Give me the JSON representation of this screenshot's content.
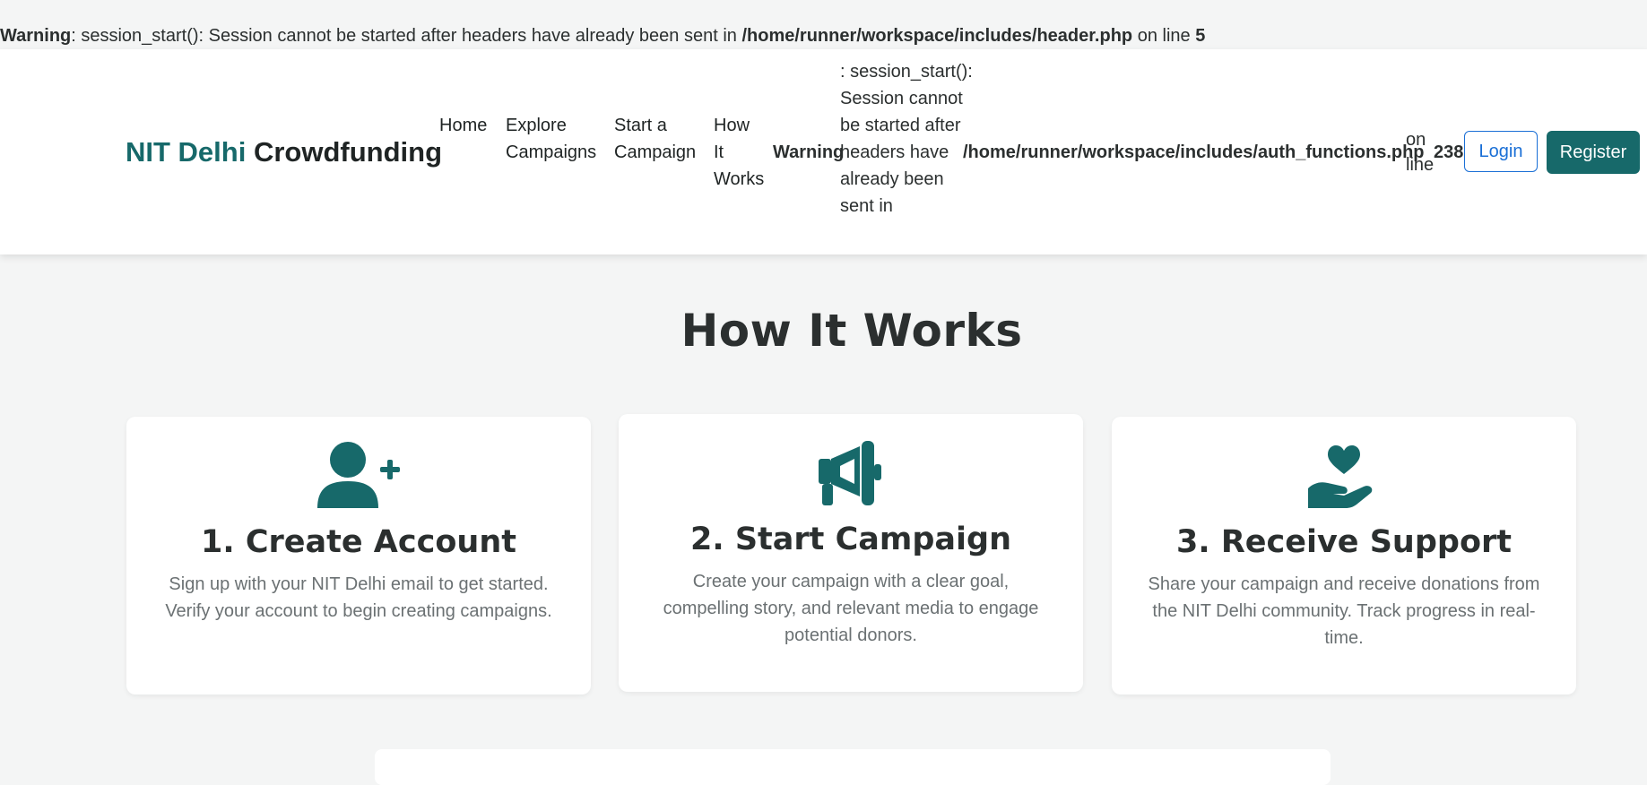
{
  "php_warning_top": {
    "label": "Warning",
    "message": ": session_start(): Session cannot be started after headers have already been sent in ",
    "path": "/home/runner/workspace/includes/header.php",
    "on_line": " on line ",
    "line": "5"
  },
  "navbar": {
    "brand_accent": "NIT Delhi",
    "brand_rest": "Crowdfunding",
    "links": [
      "Home",
      "Explore Campaigns",
      "Start a Campaign",
      "How It Works"
    ],
    "warning": {
      "label": "Warning",
      "message": ": session_start(): Session cannot be started after headers have already been sent in",
      "path": "/home/runner/workspace/includes/auth_functions.php",
      "on_line": "on line",
      "line": "238"
    },
    "login_label": "Login",
    "register_label": "Register"
  },
  "how_it_works": {
    "title": "How It Works",
    "steps": [
      {
        "icon": "user-plus-icon",
        "title": "1. Create Account",
        "desc": "Sign up with your NIT Delhi email to get started. Verify your account to begin creating campaigns."
      },
      {
        "icon": "megaphone-icon",
        "title": "2. Start Campaign",
        "desc": "Create your campaign with a clear goal, compelling story, and relevant media to engage potential donors."
      },
      {
        "icon": "hand-holding-heart-icon",
        "title": "3. Receive Support",
        "desc": "Share your campaign and receive donations from the NIT Delhi community. Track progress in real-time."
      }
    ]
  },
  "colors": {
    "accent": "#17696a",
    "link_blue": "#1a6fd6"
  }
}
